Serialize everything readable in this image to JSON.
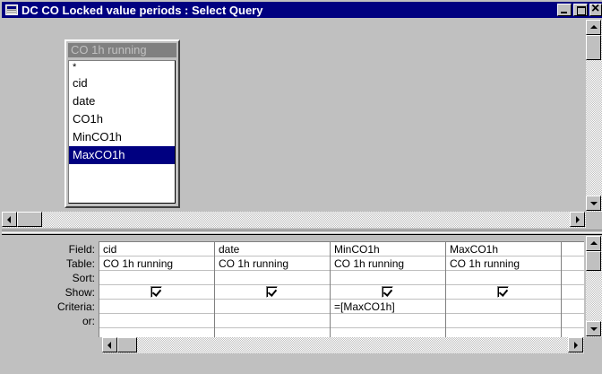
{
  "window": {
    "title": "DC CO Locked value periods : Select Query"
  },
  "table_box": {
    "title": "CO 1h running",
    "fields": [
      "*",
      "cid",
      "date",
      "CO1h",
      "MinCO1h",
      "MaxCO1h"
    ],
    "selected": "MaxCO1h"
  },
  "grid": {
    "row_labels": [
      "Field:",
      "Table:",
      "Sort:",
      "Show:",
      "Criteria:",
      "or:"
    ],
    "columns": [
      {
        "field": "cid",
        "table": "CO 1h running",
        "sort": "",
        "show": true,
        "criteria": "",
        "or": ""
      },
      {
        "field": "date",
        "table": "CO 1h running",
        "sort": "",
        "show": true,
        "criteria": "",
        "or": ""
      },
      {
        "field": "MinCO1h",
        "table": "CO 1h running",
        "sort": "",
        "show": true,
        "criteria": "=[MaxCO1h]",
        "or": ""
      },
      {
        "field": "MaxCO1h",
        "table": "CO 1h running",
        "sort": "",
        "show": true,
        "criteria": "",
        "or": ""
      },
      {
        "field": "",
        "table": "",
        "sort": "",
        "show": false,
        "criteria": "",
        "or": ""
      }
    ]
  },
  "icons": {
    "window_icon": "query-window-icon",
    "minimize": "minimize-icon",
    "maximize": "maximize-icon",
    "close": "close-icon"
  }
}
